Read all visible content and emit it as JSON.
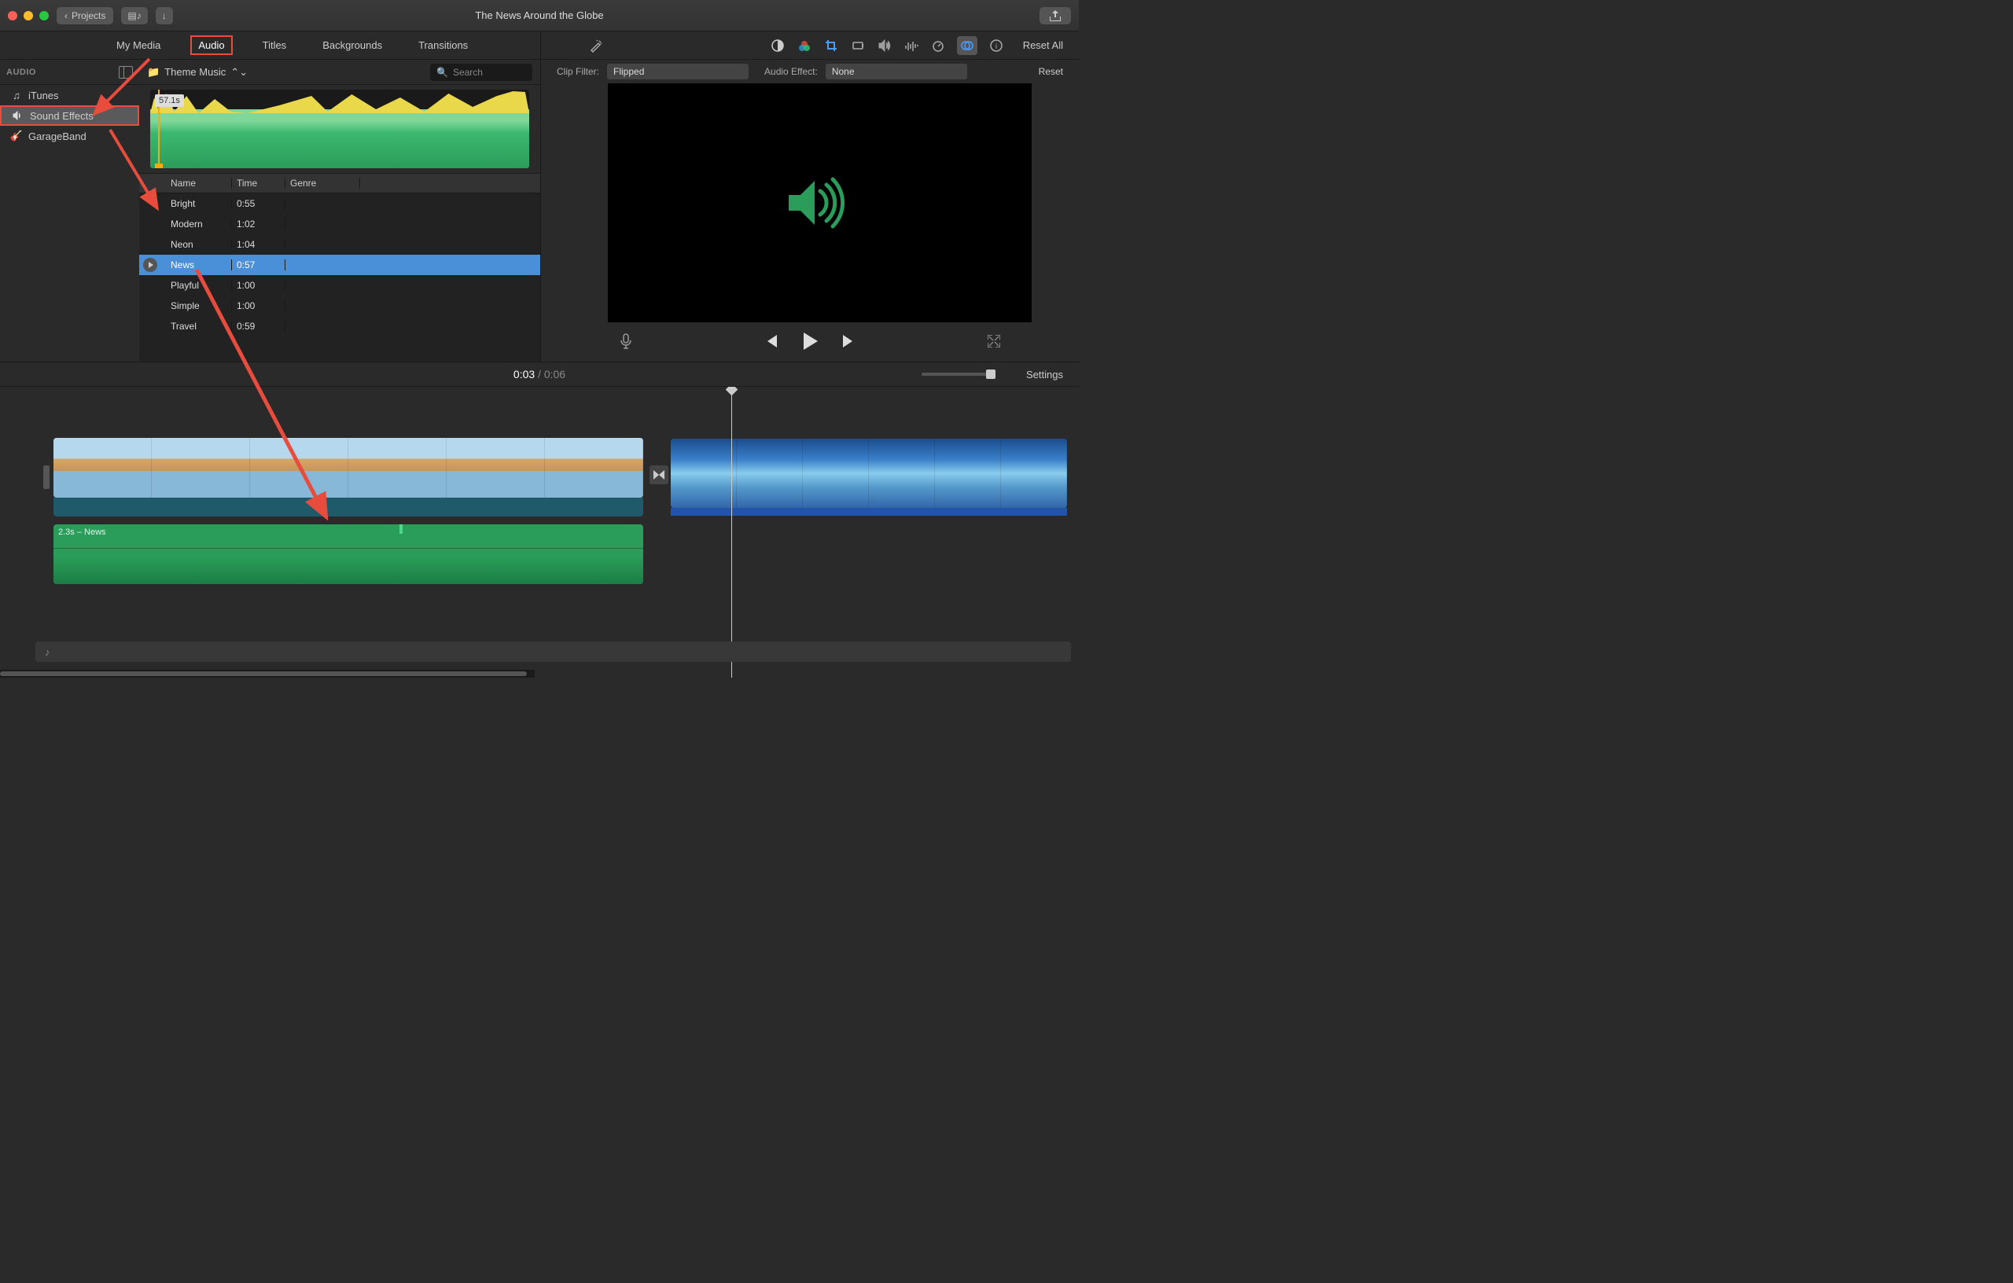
{
  "titlebar": {
    "projects_label": "Projects",
    "title": "The News Around the Globe"
  },
  "tabs": {
    "my_media": "My Media",
    "audio": "Audio",
    "titles": "Titles",
    "backgrounds": "Backgrounds",
    "transitions": "Transitions",
    "reset_all": "Reset All"
  },
  "sidebar": {
    "header": "AUDIO",
    "items": [
      {
        "label": "iTunes"
      },
      {
        "label": "Sound Effects"
      },
      {
        "label": "GarageBand"
      }
    ]
  },
  "browser": {
    "folder": "Theme Music",
    "search_placeholder": "Search",
    "wave_badge": "57.1s",
    "columns": {
      "name": "Name",
      "time": "Time",
      "genre": "Genre"
    },
    "rows": [
      {
        "name": "Bright",
        "time": "0:55"
      },
      {
        "name": "Modern",
        "time": "1:02"
      },
      {
        "name": "Neon",
        "time": "1:04"
      },
      {
        "name": "News",
        "time": "0:57"
      },
      {
        "name": "Playful",
        "time": "1:00"
      },
      {
        "name": "Simple",
        "time": "1:00"
      },
      {
        "name": "Travel",
        "time": "0:59"
      }
    ]
  },
  "filters": {
    "clip_filter_label": "Clip Filter:",
    "clip_filter_value": "Flipped",
    "audio_effect_label": "Audio Effect:",
    "audio_effect_value": "None",
    "reset": "Reset"
  },
  "timecode": {
    "current": "0:03",
    "sep": " / ",
    "total": "0:06"
  },
  "settings_label": "Settings",
  "audio_clip_label": "2.3s – News"
}
